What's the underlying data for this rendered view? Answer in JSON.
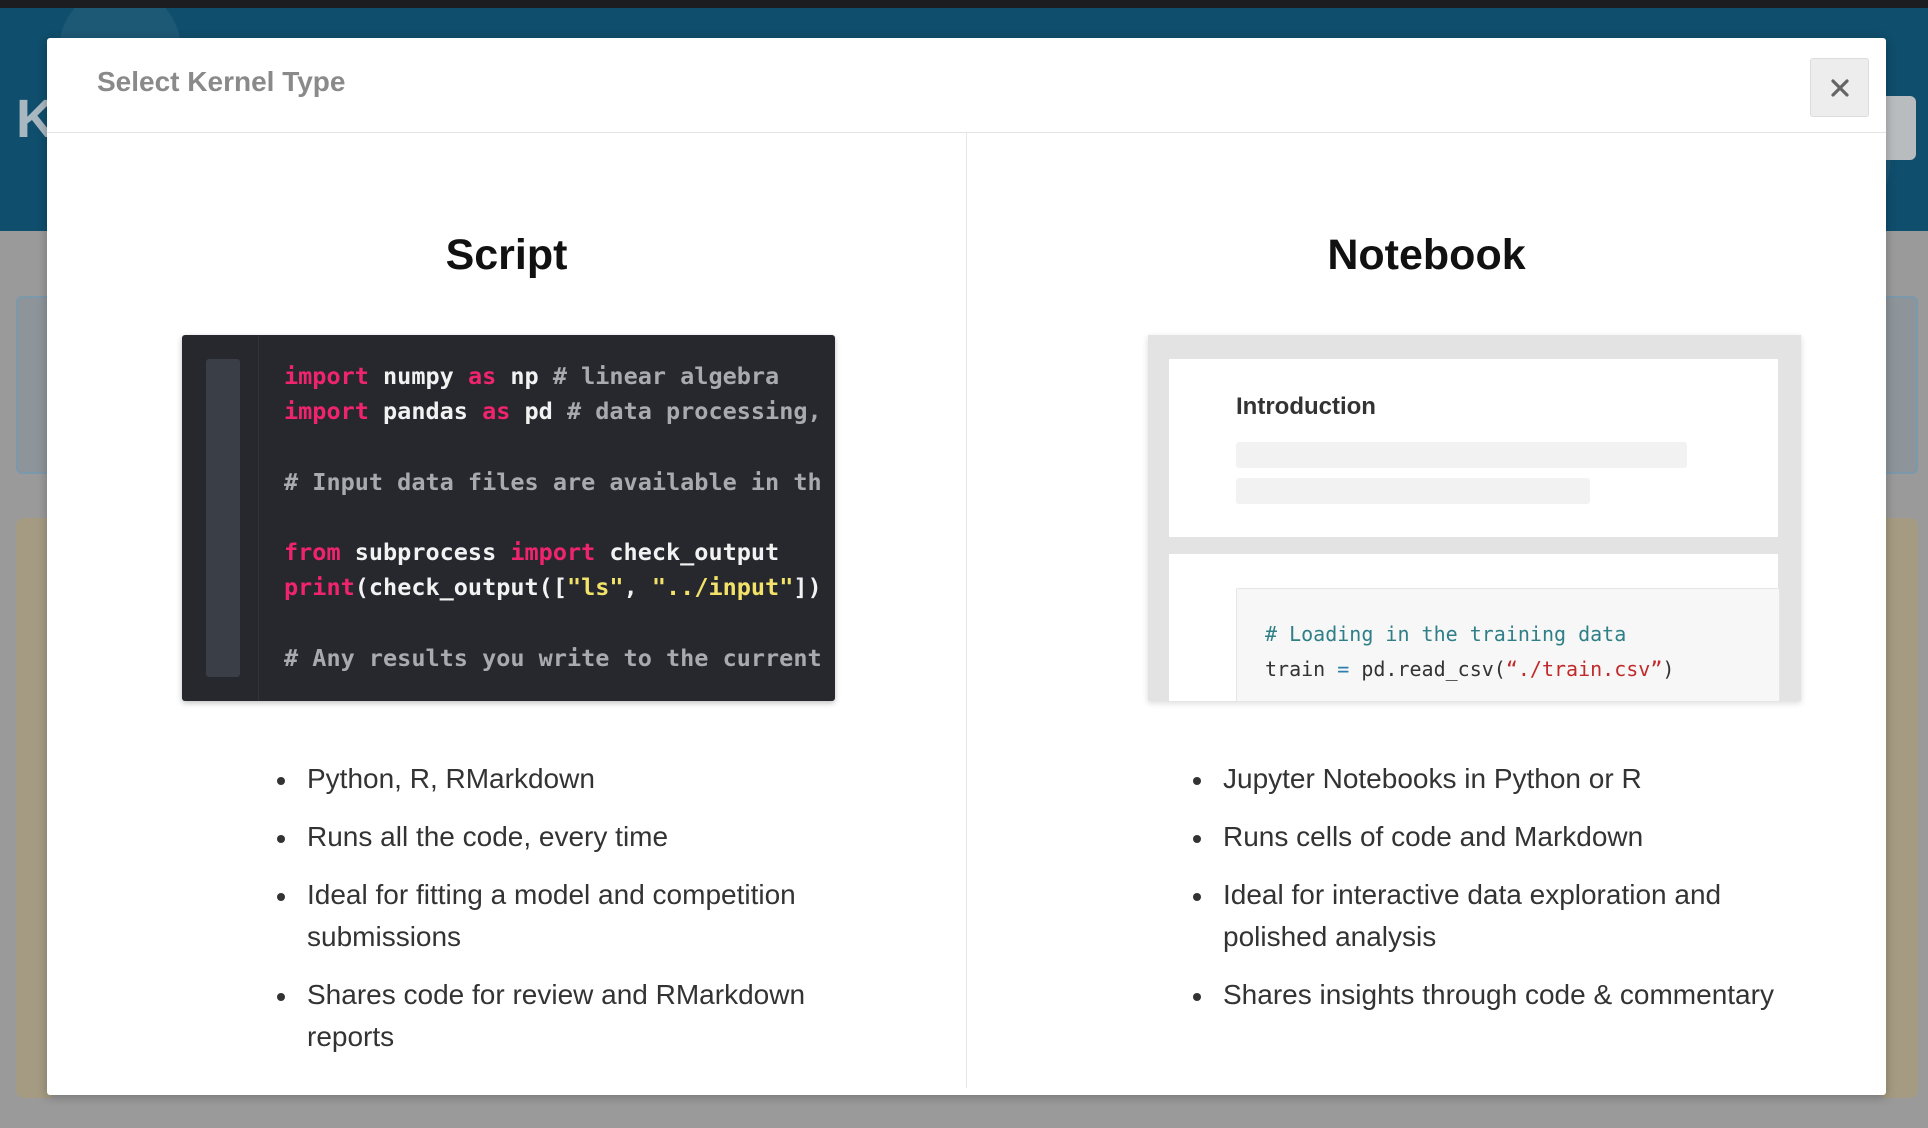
{
  "background": {
    "hero_letter": "K"
  },
  "modal": {
    "title": "Select Kernel Type",
    "close_glyph": "×"
  },
  "script": {
    "title": "Script",
    "code_lines": [
      [
        {
          "t": "import",
          "c": "kw"
        },
        {
          "t": " numpy "
        },
        {
          "t": "as",
          "c": "kw"
        },
        {
          "t": " np "
        },
        {
          "t": "# linear algebra",
          "c": "cm"
        }
      ],
      [
        {
          "t": "import",
          "c": "kw"
        },
        {
          "t": " pandas "
        },
        {
          "t": "as",
          "c": "kw"
        },
        {
          "t": " pd "
        },
        {
          "t": "# data processing,",
          "c": "cm"
        }
      ],
      [],
      [
        {
          "t": "# Input data files are available in th",
          "c": "cm"
        }
      ],
      [],
      [
        {
          "t": "from",
          "c": "kw"
        },
        {
          "t": " subprocess "
        },
        {
          "t": "import",
          "c": "kw"
        },
        {
          "t": " check_output"
        }
      ],
      [
        {
          "t": "print",
          "c": "kw"
        },
        {
          "t": "(check_output(["
        },
        {
          "t": "\"ls\"",
          "c": "str"
        },
        {
          "t": ", "
        },
        {
          "t": "\"../input\"",
          "c": "str"
        },
        {
          "t": "])"
        }
      ],
      [],
      [
        {
          "t": "# Any results you write to the current",
          "c": "cm"
        }
      ]
    ],
    "features": [
      "Python, R, RMarkdown",
      "Runs all the code, every time",
      "Ideal for fitting a model and competition submissions",
      "Shares code for review and RMarkdown reports"
    ]
  },
  "notebook": {
    "title": "Notebook",
    "intro_heading": "Introduction",
    "code_lines": [
      [
        {
          "t": "# Loading in the training data",
          "c": "nb-cm"
        }
      ],
      [
        {
          "t": "train "
        },
        {
          "t": "=",
          "c": "nb-op"
        },
        {
          "t": " pd.read_csv("
        },
        {
          "t": "“./train.csv”",
          "c": "nb-str"
        },
        {
          "t": ")"
        }
      ]
    ],
    "features": [
      "Jupyter Notebooks in Python or R",
      "Runs cells of code and Markdown",
      "Ideal for interactive data exploration and polished analysis",
      "Shares insights through code & commentary"
    ]
  }
}
